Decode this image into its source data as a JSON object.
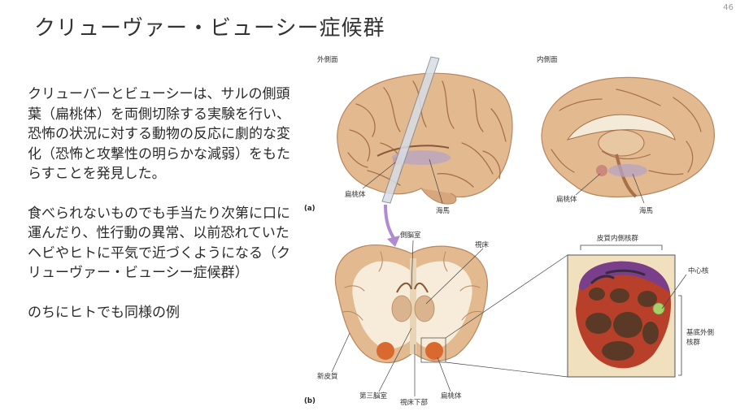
{
  "page_number": "46",
  "title": "クリューヴァー・ビューシー症候群",
  "paragraphs": [
    "クリューバーとビューシーは、サルの側頭葉（扁桃体）を両側切除する実験を行い、恐怖の状況に対する動物の反応に劇的な変化（恐怖と攻撃性の明らかな減弱）をもたらすことを発見した。",
    "食べられないものでも手当たり次第に口に運んだり、性行動の異常、以前恐れていたヘビやヒトに平気で近づくようになる（クリューヴァー・ビューシー症候群）",
    "のちにヒトでも同様の例"
  ],
  "figure": {
    "labels": {
      "lateral": "外側面",
      "medial": "内側面",
      "panel_a": "(a)",
      "panel_b": "(b)",
      "amygdala_a1": "扁桃体",
      "hippocampus_a1": "海馬",
      "amygdala_a2": "扁桃体",
      "hippocampus_a2": "海馬",
      "lateral_ventricle": "側脳室",
      "thalamus": "視床",
      "neocortex": "新皮質",
      "third_ventricle": "第三脳室",
      "hypothalamus": "視床下部",
      "amygdala_b": "扁桃体",
      "corticomedial": "皮質内側核群",
      "central_nucleus": "中心核",
      "basolateral_1": "基底外側",
      "basolateral_2": "核群"
    },
    "colors": {
      "brain": "#e3b98f",
      "sulcus": "#a8704a",
      "amygdala": "#d9692f",
      "inset_bg": "#f1e0bd",
      "purple": "#7a3f8a",
      "red": "#b8402a",
      "dark": "#5a3a26",
      "green": "#a9cf6a",
      "arrow": "#b18ad0"
    }
  }
}
